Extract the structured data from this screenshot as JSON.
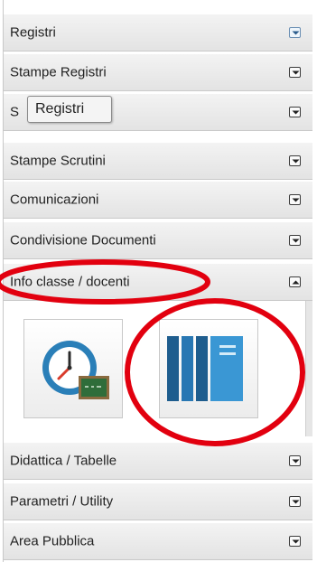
{
  "menu": {
    "items": [
      {
        "label": "Registri",
        "state": "hover"
      },
      {
        "label": "Stampe Registri",
        "state": "collapsed"
      },
      {
        "label": "S",
        "state": "collapsed"
      },
      {
        "label": "Stampe Scrutini",
        "state": "collapsed"
      },
      {
        "label": "Comunicazioni",
        "state": "collapsed"
      },
      {
        "label": "Condivisione Documenti",
        "state": "collapsed"
      },
      {
        "label": "Info classe / docenti",
        "state": "expanded"
      },
      {
        "label": "Didattica / Tabelle",
        "state": "collapsed"
      },
      {
        "label": "Parametri / Utility",
        "state": "collapsed"
      },
      {
        "label": "Area Pubblica",
        "state": "collapsed"
      }
    ]
  },
  "tooltip": {
    "text": "Registri"
  },
  "expanded_section": {
    "tiles": [
      {
        "icon": "clock-blackboard-icon"
      },
      {
        "icon": "book-binder-icon"
      }
    ]
  },
  "annotations": {
    "color": "#e2000f"
  }
}
